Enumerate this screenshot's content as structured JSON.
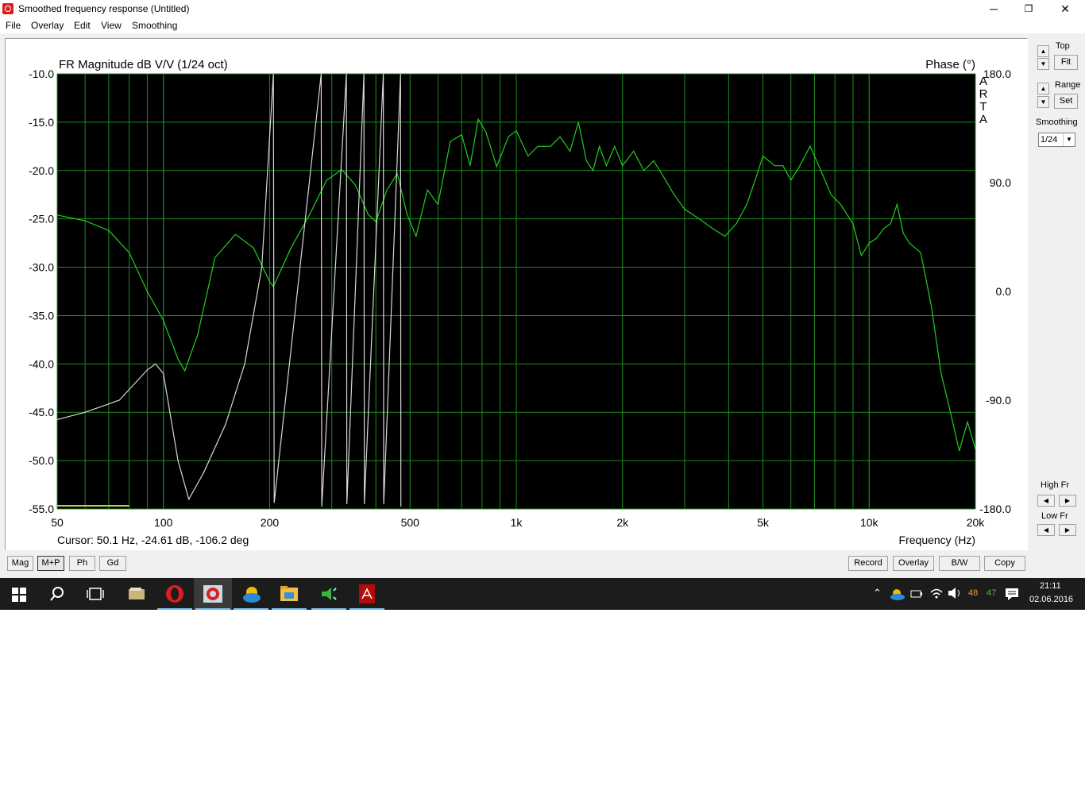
{
  "window": {
    "title": "Smoothed frequency response (Untitled)",
    "minimize": "─",
    "maximize": "❐",
    "close": "✕"
  },
  "menu": [
    "File",
    "Overlay",
    "Edit",
    "View",
    "Smoothing"
  ],
  "graph": {
    "title_left": "FR Magnitude dB V/V (1/24 oct)",
    "title_right": "Phase (°)",
    "brand": [
      "A",
      "R",
      "T",
      "A"
    ],
    "cursor_text": "Cursor: 50.1 Hz, -24.61 dB, -106.2 deg",
    "xlabel": "Frequency (Hz)",
    "colors": {
      "background": "#000000",
      "grid": "#1e8c1e",
      "magnitude": "#20d020",
      "phase": "#d8d8d8",
      "cursor_marker": "#c8c850"
    }
  },
  "chart_data": {
    "type": "line",
    "x_scale": "log",
    "xlim": [
      50,
      20000
    ],
    "ylim_left": [
      -55,
      -10
    ],
    "ylim_right": [
      -180,
      180
    ],
    "x_ticks": [
      "50",
      "100",
      "200",
      "500",
      "1k",
      "2k",
      "5k",
      "10k",
      "20k"
    ],
    "x_tick_values": [
      50,
      100,
      200,
      500,
      1000,
      2000,
      5000,
      10000,
      20000
    ],
    "y_ticks_left": [
      "-10.0",
      "-15.0",
      "-20.0",
      "-25.0",
      "-30.0",
      "-35.0",
      "-40.0",
      "-45.0",
      "-50.0",
      "-55.0"
    ],
    "y_ticks_right": [
      "180.0",
      "90.0",
      "0.0",
      "-90.0",
      "-180.0"
    ],
    "grid": true,
    "series": [
      {
        "name": "FR Magnitude",
        "axis": "left",
        "points": [
          [
            50,
            -24.6
          ],
          [
            60,
            -25.2
          ],
          [
            70,
            -26.2
          ],
          [
            80,
            -28.5
          ],
          [
            90,
            -32.5
          ],
          [
            100,
            -35.5
          ],
          [
            110,
            -39.5
          ],
          [
            115,
            -40.7
          ],
          [
            125,
            -37
          ],
          [
            140,
            -29
          ],
          [
            160,
            -26.6
          ],
          [
            180,
            -28
          ],
          [
            200,
            -31.5
          ],
          [
            205,
            -32
          ],
          [
            230,
            -28
          ],
          [
            260,
            -24.5
          ],
          [
            290,
            -21
          ],
          [
            320,
            -19.9
          ],
          [
            350,
            -21.5
          ],
          [
            380,
            -24.5
          ],
          [
            400,
            -25.3
          ],
          [
            430,
            -22
          ],
          [
            460,
            -20.3
          ],
          [
            490,
            -24.5
          ],
          [
            520,
            -26.8
          ],
          [
            560,
            -22
          ],
          [
            600,
            -23.5
          ],
          [
            650,
            -17
          ],
          [
            700,
            -16.3
          ],
          [
            740,
            -19.5
          ],
          [
            780,
            -14.7
          ],
          [
            820,
            -16
          ],
          [
            880,
            -19.6
          ],
          [
            950,
            -16.5
          ],
          [
            1000,
            -15.9
          ],
          [
            1080,
            -18.5
          ],
          [
            1150,
            -17.5
          ],
          [
            1250,
            -17.5
          ],
          [
            1330,
            -16.5
          ],
          [
            1420,
            -18
          ],
          [
            1500,
            -15
          ],
          [
            1580,
            -19
          ],
          [
            1650,
            -20
          ],
          [
            1720,
            -17.5
          ],
          [
            1800,
            -19.5
          ],
          [
            1900,
            -17.5
          ],
          [
            2000,
            -19.5
          ],
          [
            2150,
            -18
          ],
          [
            2300,
            -20
          ],
          [
            2450,
            -19
          ],
          [
            2600,
            -20.5
          ],
          [
            2800,
            -22.5
          ],
          [
            3000,
            -24
          ],
          [
            3300,
            -25
          ],
          [
            3600,
            -26
          ],
          [
            3900,
            -26.8
          ],
          [
            4200,
            -25.5
          ],
          [
            4500,
            -23.5
          ],
          [
            4800,
            -20.5
          ],
          [
            5000,
            -18.5
          ],
          [
            5400,
            -19.5
          ],
          [
            5700,
            -19.5
          ],
          [
            6000,
            -21
          ],
          [
            6300,
            -19.8
          ],
          [
            6800,
            -17.5
          ],
          [
            7300,
            -20
          ],
          [
            7800,
            -22.5
          ],
          [
            8300,
            -23.5
          ],
          [
            9000,
            -25.5
          ],
          [
            9500,
            -28.8
          ],
          [
            10000,
            -27.5
          ],
          [
            10500,
            -27
          ],
          [
            11000,
            -26
          ],
          [
            11500,
            -25.5
          ],
          [
            12000,
            -23.5
          ],
          [
            12500,
            -26.5
          ],
          [
            13000,
            -27.5
          ],
          [
            14000,
            -28.5
          ],
          [
            15000,
            -34
          ],
          [
            16000,
            -41
          ],
          [
            17000,
            -45
          ],
          [
            18000,
            -49
          ],
          [
            19000,
            -46
          ],
          [
            20000,
            -48.8
          ]
        ]
      },
      {
        "name": "Phase",
        "axis": "right",
        "points": [
          [
            50,
            -106
          ],
          [
            60,
            -100
          ],
          [
            75,
            -90
          ],
          [
            90,
            -65
          ],
          [
            95,
            -60
          ],
          [
            100,
            -68
          ],
          [
            110,
            -140
          ],
          [
            118,
            -172
          ],
          [
            130,
            -150
          ],
          [
            150,
            -110
          ],
          [
            170,
            -60
          ],
          [
            190,
            20
          ],
          [
            205,
            180
          ],
          [
            206,
            -175
          ],
          [
            280,
            180
          ],
          [
            281,
            -178
          ],
          [
            330,
            180
          ],
          [
            331,
            -176
          ],
          [
            370,
            180
          ],
          [
            371,
            -176
          ],
          [
            420,
            180
          ],
          [
            421,
            -176
          ],
          [
            470,
            180
          ],
          [
            471,
            -178
          ]
        ]
      }
    ]
  },
  "right_panel": {
    "top_label": "Top",
    "fit_label": "Fit",
    "range_label": "Range",
    "set_label": "Set",
    "smoothing_label": "Smoothing",
    "smoothing_value": "1/24",
    "high_fr_label": "High Fr",
    "low_fr_label": "Low Fr"
  },
  "bottom_buttons_left": [
    "Mag",
    "M+P",
    "Ph",
    "Gd"
  ],
  "bottom_buttons_right": [
    "Record",
    "Overlay",
    "B/W",
    "Copy"
  ],
  "taskbar": {
    "tray_num1": "48",
    "tray_num2": "47",
    "time": "21:11",
    "date": "02.06.2016"
  }
}
